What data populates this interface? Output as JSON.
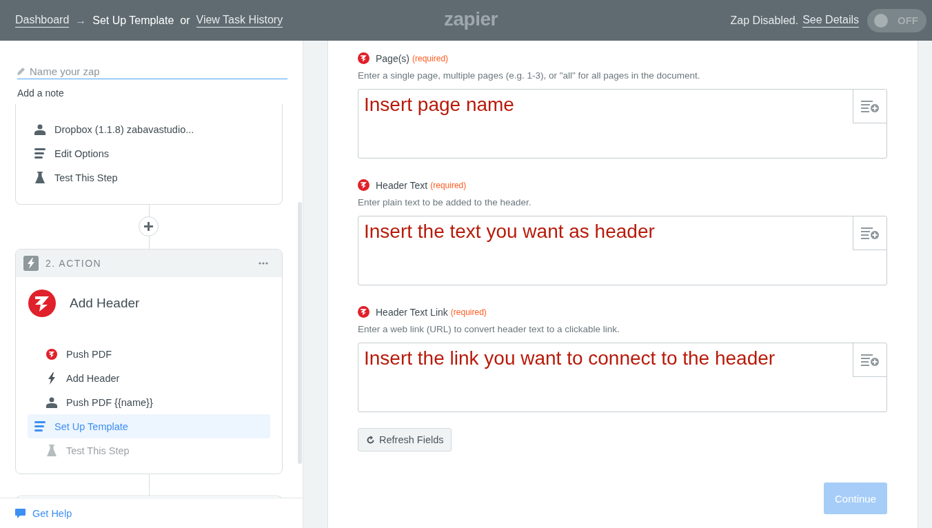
{
  "header": {
    "breadcrumb": [
      {
        "label": "Dashboard",
        "link": true
      },
      {
        "label": "→",
        "link": false
      },
      {
        "label": "Set Up Template",
        "link": false
      },
      {
        "label": "or",
        "link": false
      },
      {
        "label": "View Task History",
        "link": true
      }
    ],
    "logo": "zapier",
    "status": "Zap Disabled.",
    "status_link": "See Details",
    "toggle": {
      "on": false,
      "label": "OFF"
    }
  },
  "sidebar": {
    "name_field": {
      "placeholder": "Name your zap"
    },
    "note_link": "Add a note",
    "trigger_items": [
      {
        "kind": "person",
        "label": "Dropbox (1.1.8) zabavastudio...",
        "selected": false,
        "disabled": false
      },
      {
        "kind": "lines",
        "label": "Edit Options",
        "selected": false,
        "disabled": false
      },
      {
        "kind": "flask",
        "label": "Test This Step",
        "selected": false,
        "disabled": false
      }
    ],
    "action": {
      "step": "2. ACTION",
      "app": "Add Header",
      "items": [
        {
          "kind": "app",
          "label": "Push PDF",
          "selected": false,
          "disabled": false
        },
        {
          "kind": "bolt",
          "label": "Add Header",
          "selected": false,
          "disabled": false
        },
        {
          "kind": "person",
          "label": "Push PDF {{name}}",
          "selected": false,
          "disabled": false
        },
        {
          "kind": "lines",
          "label": "Set Up Template",
          "selected": true,
          "disabled": false
        },
        {
          "kind": "flask",
          "label": "Test This Step",
          "selected": false,
          "disabled": true
        }
      ]
    },
    "help": "Get Help"
  },
  "form": {
    "fields": [
      {
        "label": "Page(s)",
        "required": "(required)",
        "description": "Enter a single page, multiple pages (e.g. 1-3), or \"all\" for all pages in the document.",
        "value": "Insert page name"
      },
      {
        "label": "Header Text",
        "required": "(required)",
        "description": "Enter plain text to be added to the header.",
        "value": "Insert the text you want as header"
      },
      {
        "label": "Header Text Link",
        "required": "(required)",
        "description": "Enter a web link (URL) to convert header text to a clickable link.",
        "value": "Insert the link you want to connect to the header"
      }
    ],
    "refresh": "Refresh Fields",
    "continue": {
      "label": "Continue",
      "disabled": true
    }
  }
}
